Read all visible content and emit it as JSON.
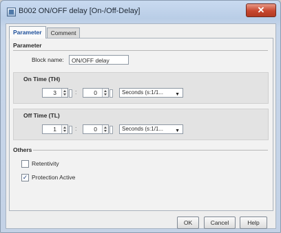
{
  "window": {
    "title": "B002 ON/OFF delay [On-/Off-Delay]",
    "close_label": "✕"
  },
  "tabs": [
    {
      "label": "Parameter",
      "active": true
    },
    {
      "label": "Comment",
      "active": false
    }
  ],
  "parameter": {
    "section_label": "Parameter",
    "block_name_label": "Block name:",
    "block_name_value": "ON/OFF delay"
  },
  "on_time": {
    "label": "On Time (TH)",
    "value1": "3",
    "separator": ":",
    "value2": "0",
    "unit": "Seconds (s:1/1..."
  },
  "off_time": {
    "label": "Off Time (TL)",
    "value1": "1",
    "separator": ":",
    "value2": "0",
    "unit": "Seconds (s:1/1..."
  },
  "others": {
    "section_label": "Others",
    "retentivity_label": "Retentivity",
    "retentivity_checked": false,
    "protection_label": "Protection Active",
    "protection_checked": true
  },
  "buttons": {
    "ok": "OK",
    "cancel": "Cancel",
    "help": "Help"
  },
  "icons": {
    "check": "✓",
    "chevron": "▼"
  }
}
